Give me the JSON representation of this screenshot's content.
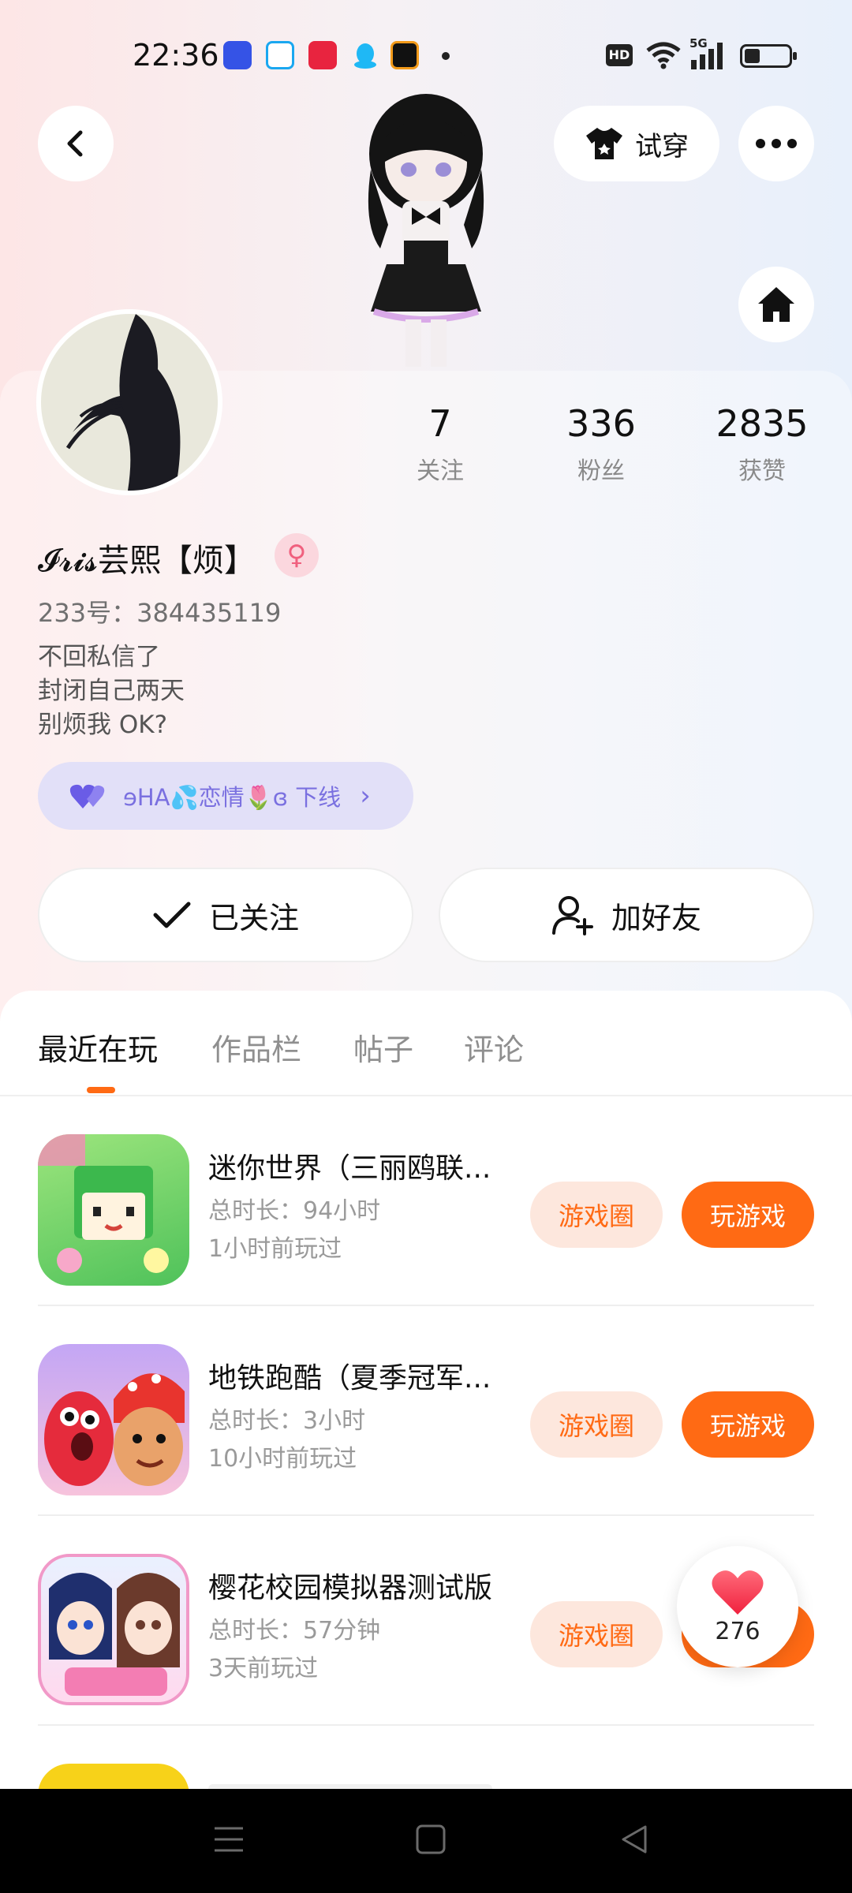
{
  "status_bar": {
    "time": "22:36",
    "hd": "HD",
    "network": "5G",
    "battery_level": 0.35,
    "notification_icons": [
      "flashlight-app-icon",
      "qq-browser-icon",
      "xiaohongshu-icon",
      "qq-icon",
      "zero-app-icon"
    ]
  },
  "header": {
    "tryon_label": "试穿"
  },
  "profile": {
    "stats": [
      {
        "value": "7",
        "label": "关注"
      },
      {
        "value": "336",
        "label": "粉丝"
      },
      {
        "value": "2835",
        "label": "获赞"
      }
    ],
    "username": "𝓘𝓻𝓲𝓼芸熙【烦】",
    "gender_symbol": "♀",
    "account_id": "233号：384435119",
    "bio_lines": [
      "不回私信了",
      "封闭自己两天",
      "别烦我 OK?"
    ],
    "relation_text": "ɘHA💦恋情🌷ɞ 下线"
  },
  "actions": {
    "followed_label": "已关注",
    "add_friend_label": "加好友"
  },
  "tabs": [
    "最近在玩",
    "作品栏",
    "帖子",
    "评论"
  ],
  "games": [
    {
      "name": "迷你世界（三丽鸥联...",
      "duration": "总时长：94小时",
      "last_played": "1小时前玩过",
      "circle_label": "游戏圈",
      "play_label": "玩游戏"
    },
    {
      "name": "地铁跑酷（夏季冠军...",
      "duration": "总时长：3小时",
      "last_played": "10小时前玩过",
      "circle_label": "游戏圈",
      "play_label": "玩游戏"
    },
    {
      "name": "樱花校园模拟器测试版",
      "duration": "总时长：57分钟",
      "last_played": "3天前玩过",
      "circle_label": "游戏圈",
      "play_label": "玩游戏"
    }
  ],
  "like_fab": {
    "count": "276"
  },
  "colors": {
    "accent": "#ff6a14",
    "accent_light": "#fde7dd",
    "relation_text": "#7a70e0",
    "relation_bg": "#e2e0f8"
  }
}
